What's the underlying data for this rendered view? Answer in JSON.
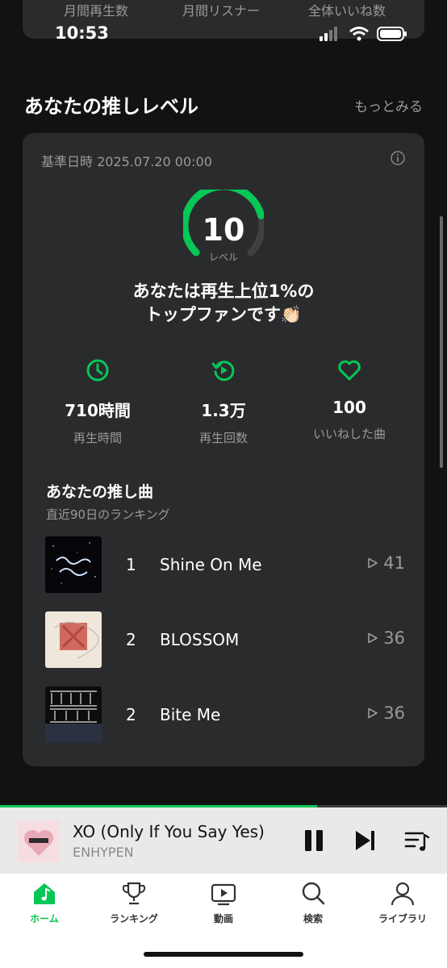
{
  "status_bar": {
    "time": "10:53"
  },
  "top_stats": {
    "labels": [
      "月間再生数",
      "月間リスナー",
      "全体いいね数"
    ]
  },
  "section": {
    "title": "あなたの推しレベル",
    "more": "もっとみる"
  },
  "card": {
    "ref_date": "基準日時 2025.07.20 00:00",
    "level": {
      "value": "10",
      "label": "レベル",
      "gauge_fraction": 0.78
    },
    "message_line1": "あなたは再生上位1%の",
    "message_line2": "トップファンです👏🏻",
    "stats": [
      {
        "icon": "clock-icon",
        "value": "710時間",
        "label": "再生時間"
      },
      {
        "icon": "replay-icon",
        "value": "1.3万",
        "label": "再生回数"
      },
      {
        "icon": "heart-icon",
        "value": "100",
        "label": "いいねした曲"
      }
    ]
  },
  "favorites": {
    "title": "あなたの推し曲",
    "subtitle": "直近90日のランキング",
    "songs": [
      {
        "rank": "1",
        "title": "Shine On Me",
        "plays": "41"
      },
      {
        "rank": "2",
        "title": "BLOSSOM",
        "plays": "36"
      },
      {
        "rank": "2",
        "title": "Bite Me",
        "plays": "36"
      }
    ]
  },
  "player": {
    "title": "XO (Only If You Say Yes)",
    "artist": "ENHYPEN",
    "progress_fraction": 0.71
  },
  "tabs": [
    {
      "icon": "home-icon",
      "label": "ホーム",
      "active": true
    },
    {
      "icon": "trophy-icon",
      "label": "ランキング",
      "active": false
    },
    {
      "icon": "video-icon",
      "label": "動画",
      "active": false
    },
    {
      "icon": "search-icon",
      "label": "検索",
      "active": false
    },
    {
      "icon": "person-icon",
      "label": "ライブラリ",
      "active": false
    }
  ],
  "colors": {
    "accent": "#06c755",
    "background": "#121212",
    "card": "#2a2b2d",
    "muted": "#9a9a9a"
  }
}
